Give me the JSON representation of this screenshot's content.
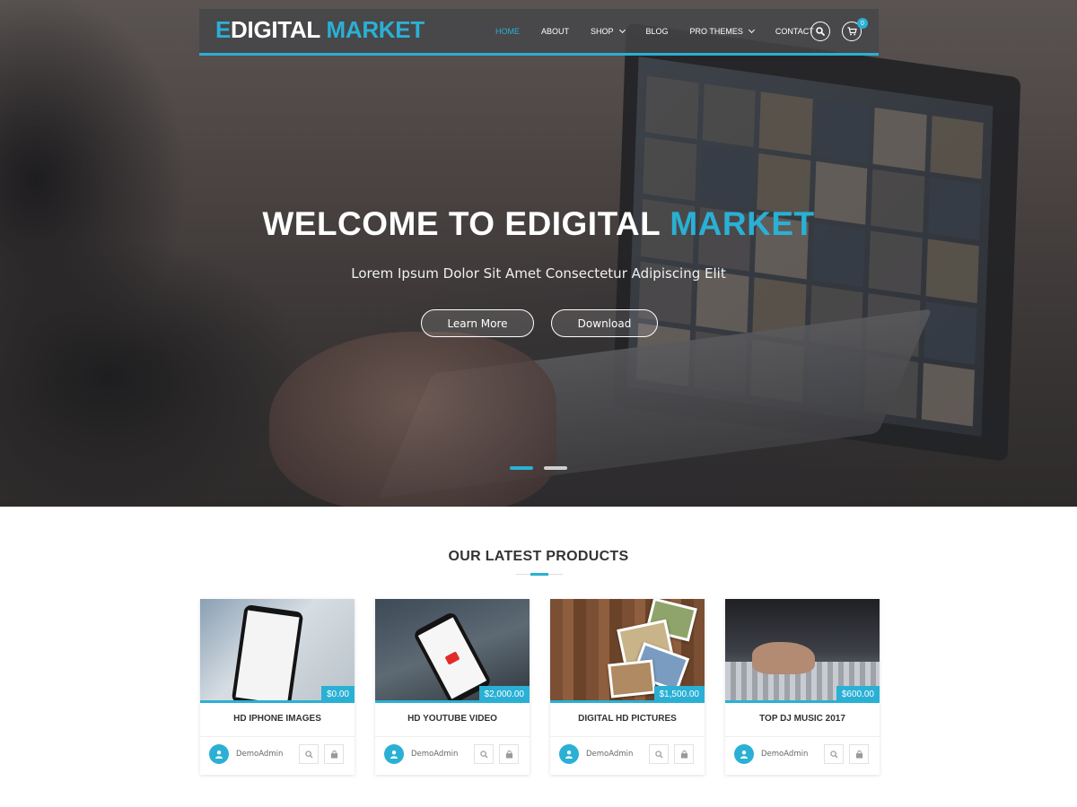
{
  "brand": {
    "logo_part1": "E",
    "logo_part2": "DIGITAL",
    "logo_part3": "MARKET",
    "accent_color": "#2ab0d5"
  },
  "nav": {
    "items": [
      {
        "label": "HOME",
        "active": true
      },
      {
        "label": "ABOUT",
        "active": false
      },
      {
        "label": "SHOP",
        "active": false,
        "dropdown": true
      },
      {
        "label": "BLOG",
        "active": false
      },
      {
        "label": "PRO THEMES",
        "active": false,
        "dropdown": true
      },
      {
        "label": "CONTACT",
        "active": false
      }
    ],
    "search_icon": "search-icon",
    "cart_icon": "cart-icon",
    "cart_count": "0"
  },
  "hero": {
    "title_main": "WELCOME TO EDIGITAL ",
    "title_highlight": "MARKET",
    "subtitle": "Lorem Ipsum Dolor Sit Amet Consectetur Adipiscing Elit",
    "btn_learn": "Learn More",
    "btn_download": "Download",
    "slides_total": 2,
    "active_slide": 1
  },
  "products": {
    "section_title": "OUR LATEST PRODUCTS",
    "items": [
      {
        "name": "HD IPHONE IMAGES",
        "price": "$0.00",
        "author": "DemoAdmin"
      },
      {
        "name": "HD YOUTUBE VIDEO",
        "price": "$2,000.00",
        "author": "DemoAdmin"
      },
      {
        "name": "DIGITAL HD PICTURES",
        "price": "$1,500.00",
        "author": "DemoAdmin"
      },
      {
        "name": "TOP DJ MUSIC 2017",
        "price": "$600.00",
        "author": "DemoAdmin"
      }
    ]
  }
}
